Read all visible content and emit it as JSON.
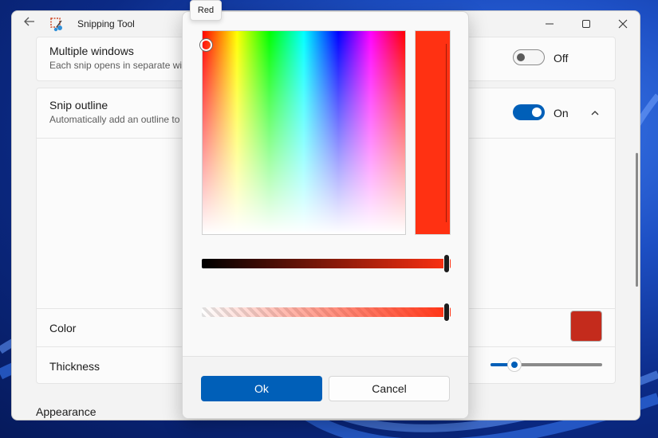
{
  "window": {
    "title": "Snipping Tool",
    "back_icon": "back-arrow-icon",
    "minimize_icon": "minimize-icon",
    "maximize_icon": "maximize-icon",
    "close_icon": "close-icon"
  },
  "settings": {
    "multiple_windows": {
      "title": "Multiple windows",
      "description": "Each snip opens in separate wi",
      "toggle_state": "Off"
    },
    "snip_outline": {
      "title": "Snip outline",
      "description": "Automatically add an outline to",
      "toggle_state": "On"
    },
    "color": {
      "label": "Color",
      "swatch_hex": "#c42b1c"
    },
    "thickness": {
      "label": "Thickness",
      "value_fraction": 0.2
    },
    "appearance_heading": "Appearance"
  },
  "color_picker": {
    "tooltip": "Red",
    "selected_color": "#ff3112",
    "value_fraction": 1.0,
    "alpha_fraction": 1.0,
    "ok_label": "Ok",
    "cancel_label": "Cancel"
  },
  "colors": {
    "accent": "#005fb8"
  }
}
